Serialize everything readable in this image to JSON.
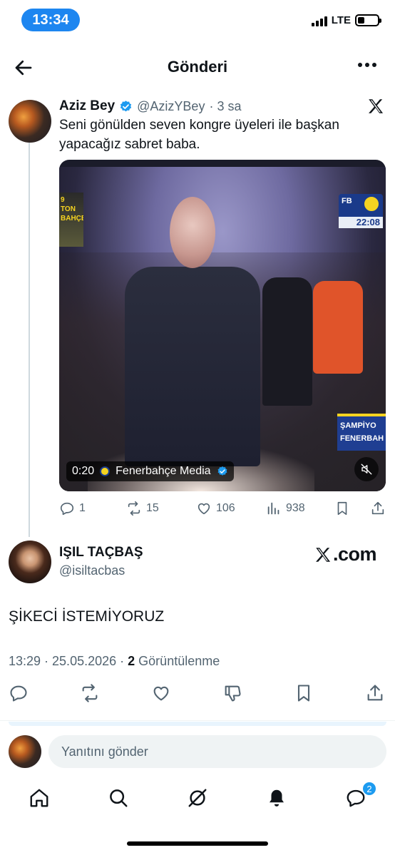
{
  "status_bar": {
    "time": "13:34",
    "network": "LTE",
    "battery_level": 0.35
  },
  "header": {
    "title": "Gönderi"
  },
  "quoted_tweet": {
    "name": "Aziz Bey",
    "handle": "@AzizYBey",
    "time": "· 3 sa",
    "text": "Seni gönülden seven kongre üyeleri ile başkan yapacağız sabret baba.",
    "video": {
      "duration": "0:20",
      "source": "Fenerbahçe Media",
      "tv_logo_text": "FB",
      "tv_clock": "22:08",
      "banner_line1": "ŞAMPİYO",
      "banner_line2": "FENERBAH",
      "badge_line1": "9",
      "badge_line2": "TON",
      "badge_line3": "BAHÇE"
    },
    "replies": "1",
    "reposts": "15",
    "likes": "106",
    "views": "938"
  },
  "original": {
    "name": "IŞIL TAÇBAŞ",
    "handle": "@isiltacbas",
    "watermark": ".com",
    "text": "ŞİKECİ İSTEMİYORUZ",
    "timestamp": "13:29 · 25.05.2026 ·",
    "views_count": "2",
    "views_label": "Görüntülenme"
  },
  "reply": {
    "placeholder": "Yanıtını gönder"
  },
  "nav": {
    "messages_badge": "2"
  },
  "colors": {
    "accent": "#1d9bf0",
    "text": "#0f1419",
    "muted": "#536471",
    "time_pill": "#1d86f0"
  }
}
